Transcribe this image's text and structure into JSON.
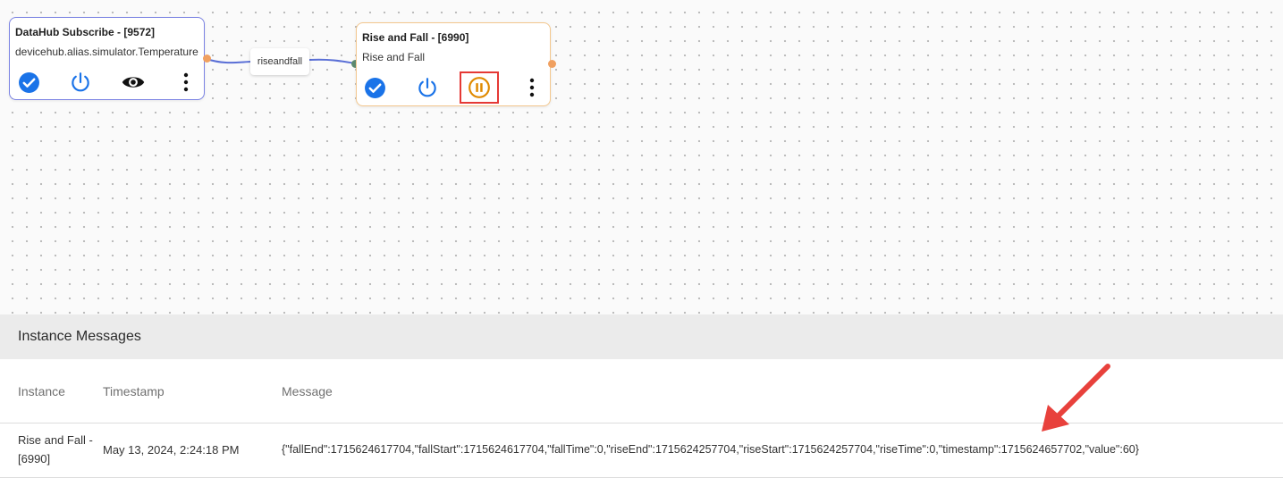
{
  "flow": {
    "edge_label": "riseandfall",
    "nodes": [
      {
        "title": "DataHub Subscribe - [9572]",
        "subtitle": "devicehub.alias.simulator.Temperature",
        "actions": [
          "check-circle-icon",
          "power-icon",
          "eye-icon",
          "more-vert-icon"
        ]
      },
      {
        "title": "Rise and Fall - [6990]",
        "subtitle": "Rise and Fall",
        "actions": [
          "check-circle-icon",
          "power-icon",
          "pause-circle-icon",
          "more-vert-icon"
        ]
      }
    ]
  },
  "messages_panel": {
    "title": "Instance Messages",
    "columns": [
      "Instance",
      "Timestamp",
      "Message"
    ],
    "rows": [
      {
        "instance": "Rise and Fall - [6990]",
        "timestamp": "May 13, 2024, 2:24:18 PM",
        "message": "{\"fallEnd\":1715624617704,\"fallStart\":1715624617704,\"fallTime\":0,\"riseEnd\":1715624257704,\"riseStart\":1715624257704,\"riseTime\":0,\"timestamp\":1715624657702,\"value\":60}"
      }
    ]
  },
  "colors": {
    "accent_blue": "#1a73e8",
    "pause_orange": "#e08a00",
    "highlight_red": "#e53935",
    "wire_blue": "#5a6fd6",
    "port_orange": "#f0a060",
    "port_green": "#5d8a6f"
  }
}
